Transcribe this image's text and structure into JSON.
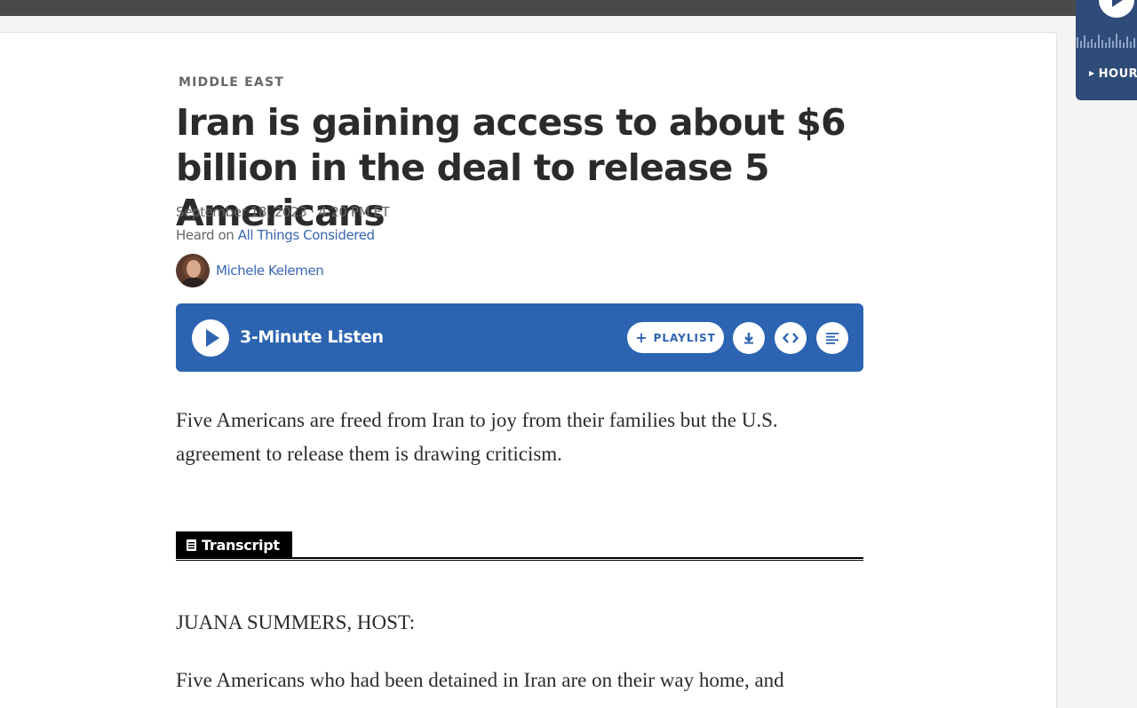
{
  "article": {
    "section": "MIDDLE EAST",
    "headline": "Iran is gaining access to about $6 billion in the deal to release 5 Americans",
    "date": "September 18, 2023",
    "separator": "·",
    "time": "4:20 PM ET",
    "heard_on_prefix": "Heard on",
    "program": "All Things Considered",
    "author": "Michele Kelemen",
    "teaser": "Five Americans are freed from Iran to joy from their families but the U.S. agreement to release them is drawing criticism."
  },
  "player": {
    "listen_label": "3-Minute Listen",
    "playlist_label": "PLAYLIST",
    "playlist_icon": "plus-icon",
    "download_icon": "download-icon",
    "embed_icon": "embed-icon",
    "transcript_icon": "text-lines-icon",
    "color": "#2c64b1"
  },
  "transcript": {
    "tab_label": "Transcript",
    "speaker": "JUANA SUMMERS, HOST:",
    "first_line": "Five Americans who had been detained in Iran are on their way home, and"
  },
  "side_player": {
    "label": "HOUR",
    "color": "#2f4b78"
  }
}
